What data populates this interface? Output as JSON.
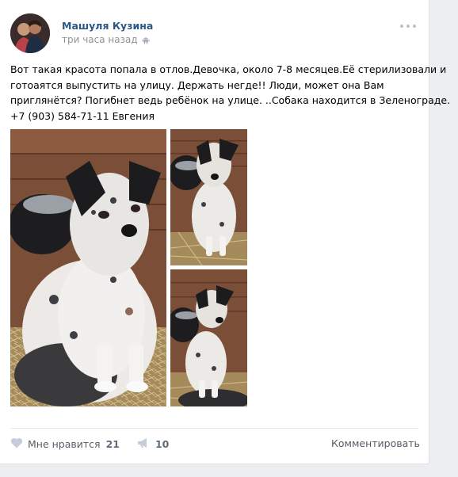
{
  "post": {
    "author": "Машуля Кузина",
    "time": "три часа назад",
    "platform_icon": "android-icon",
    "text_lines": [
      "Вот такая красота попала в отлов.Девочка, около 7-8 месяцев.Её стерилизовали и",
      "готоаятся выпустить на улицу. Держать негде!! Люди, может она Вам",
      "приглянётся? Погибнет ведь ребёнок на улице. ..Собака находится в Зеленограде.",
      "+7 (903) 584-71-11 Евгения"
    ],
    "photos": [
      "puppy-photo-1",
      "puppy-photo-2",
      "puppy-photo-3"
    ]
  },
  "actions": {
    "like_label": "Мне нравится",
    "like_count": "21",
    "share_count": "10",
    "comment_label": "Комментировать"
  },
  "colors": {
    "link": "#2a5885",
    "muted": "#939393",
    "icon": "#b8c1cc",
    "background": "#edeef0"
  }
}
